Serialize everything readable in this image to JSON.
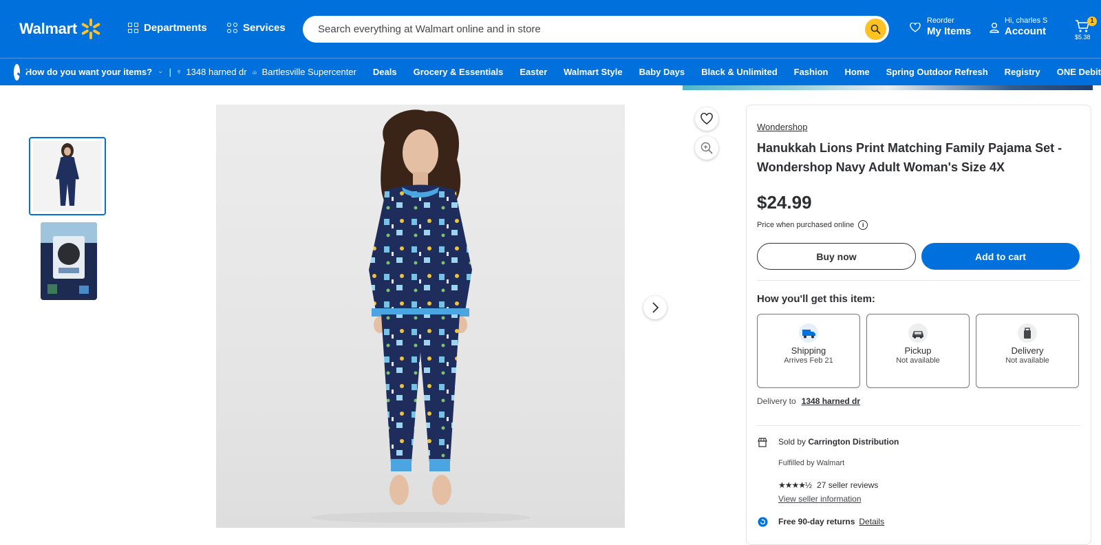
{
  "header": {
    "logo_text": "Walmart",
    "departments": "Departments",
    "services": "Services",
    "search_placeholder": "Search everything at Walmart online and in store",
    "reorder_small": "Reorder",
    "reorder_big": "My Items",
    "account_small": "Hi, charles S",
    "account_big": "Account",
    "cart_count": "1",
    "cart_amount": "$5.38"
  },
  "subnav": {
    "how_label": "How do you want your items?",
    "separator": "|",
    "address": "1348 harned dr",
    "store": "Bartlesville Supercenter",
    "categories": [
      "Deals",
      "Grocery & Essentials",
      "Easter",
      "Walmart Style",
      "Baby Days",
      "Black & Unlimited",
      "Fashion",
      "Home",
      "Spring Outdoor Refresh",
      "Registry",
      "ONE Debit"
    ]
  },
  "product": {
    "brand": "Wondershop",
    "title": "Hanukkah Lions Print Matching Family Pajama Set - Wondershop Navy Adult Woman's Size 4X",
    "price": "$24.99",
    "price_note": "Price when purchased online",
    "buy_now": "Buy now",
    "add_to_cart": "Add to cart",
    "how_get": "How you'll get this item:",
    "options": [
      {
        "name": "Shipping",
        "sub": "Arrives Feb 21",
        "icon": "truck-icon"
      },
      {
        "name": "Pickup",
        "sub": "Not available",
        "icon": "car-icon"
      },
      {
        "name": "Delivery",
        "sub": "Not available",
        "icon": "bag-icon"
      }
    ],
    "delivery_to_label": "Delivery to",
    "delivery_to_address": "1348 harned dr",
    "sold_by_label": "Sold by",
    "sold_by": "Carrington Distribution",
    "fulfilled": "Fulfilled by Walmart",
    "stars": "★★★★½",
    "rating": 4.5,
    "seller_reviews": "27 seller reviews",
    "view_seller": "View seller information",
    "returns": "Free 90-day returns",
    "details": "Details"
  },
  "colors": {
    "brand_blue": "#0071dc",
    "spark_yellow": "#ffc220",
    "text": "#2e2f32"
  }
}
